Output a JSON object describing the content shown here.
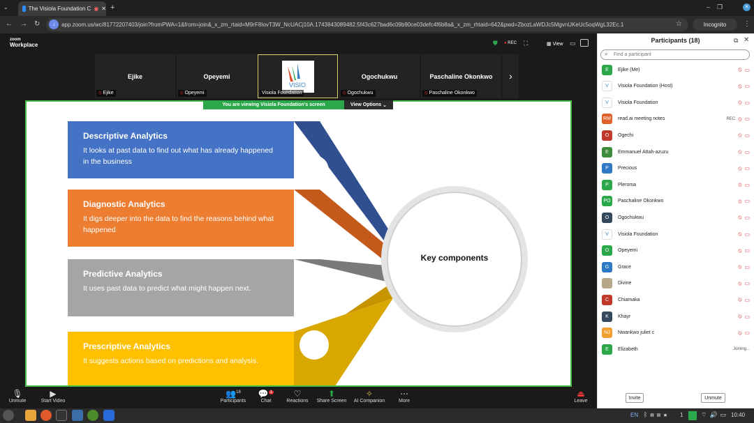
{
  "browser": {
    "tab_title": "The Visiola Foundation C",
    "url": "app.zoom.us/wc/81772207403/join?fromPWA=1&from=join&_x_zm_rtaid=M9rF8IovT3W_NcUACj10A.1743843089482.5f43c627bad6c09b90ce03defc4f6b8a&_x_zm_rhtaid=642&pwd=ZbozLaWDJc5MgvnUKeUc5oqWgL32Ec.1",
    "incognito_label": "Incognito"
  },
  "zoom": {
    "logo_line1": "zoom",
    "logo_line2": "Workplace",
    "rec_label": "REC",
    "view_label": "View",
    "videos": [
      {
        "name": "Ejike",
        "label": "Ejike"
      },
      {
        "name": "Opeyemi",
        "label": "Opeyemi"
      },
      {
        "name": "",
        "label": "Visiola Foundation"
      },
      {
        "name": "Ogochukwu",
        "label": "Ogochukwu"
      },
      {
        "name": "Paschaline Okonkwo",
        "label": "Paschaline Okonkwo"
      }
    ],
    "viewing_banner": "You are viewing  Visiola Foundation's screen",
    "view_options": "View Options"
  },
  "slide": {
    "cards": [
      {
        "title": "Descriptive Analytics",
        "desc": "It looks at past data to find out what has already happened in the business",
        "color": "#4472c4"
      },
      {
        "title": "Diagnostic Analytics",
        "desc": "It digs deeper into the data to find the reasons behind what happened",
        "color": "#ed7d31"
      },
      {
        "title": "Predictive Analytics",
        "desc": "It uses past data to predict what might happen next.",
        "color": "#a5a5a5"
      },
      {
        "title": "Prescriptive Analytics",
        "desc": "It suggests actions based on predictions and analysis.",
        "color": "#ffc000"
      }
    ],
    "center_label": "Key components"
  },
  "toolbar": {
    "items": [
      {
        "label": "Unmute",
        "icon": "mic-off-icon"
      },
      {
        "label": "Start Video",
        "icon": "video-off-icon"
      },
      {
        "label": "Participants",
        "icon": "participants-icon",
        "count": "18"
      },
      {
        "label": "Chat",
        "icon": "chat-icon",
        "badge": "1"
      },
      {
        "label": "Reactions",
        "icon": "heart-icon"
      },
      {
        "label": "Share Screen",
        "icon": "share-screen-icon"
      },
      {
        "label": "AI Companion",
        "icon": "sparkle-icon"
      },
      {
        "label": "More",
        "icon": "more-icon"
      },
      {
        "label": "Leave",
        "icon": "leave-icon"
      }
    ]
  },
  "participants": {
    "title": "Participants (18)",
    "search_placeholder": "Find a participant",
    "list": [
      {
        "initials": "E",
        "name": "Ejike (Me)",
        "color": "#2aa84a",
        "status": ""
      },
      {
        "initials": "",
        "name": "Visiola Foundation (Host)",
        "color": "#ffffff",
        "status": ""
      },
      {
        "initials": "",
        "name": "Visiola Foundation",
        "color": "#ffffff",
        "status": ""
      },
      {
        "initials": "RM",
        "name": "read.ai meeting notes",
        "color": "#e0622b",
        "status": "REC"
      },
      {
        "initials": "O",
        "name": "Ogechi",
        "color": "#c0392b",
        "status": ""
      },
      {
        "initials": "E",
        "name": "Emmanuel Attah-azuzu",
        "color": "#3c8c3c",
        "status": ""
      },
      {
        "initials": "P",
        "name": "Precious",
        "color": "#2f78c4",
        "status": ""
      },
      {
        "initials": "P",
        "name": "Pleroma",
        "color": "#2aa84a",
        "status": ""
      },
      {
        "initials": "PO",
        "name": "Paschaline Okonkwo",
        "color": "#2aa84a",
        "status": ""
      },
      {
        "initials": "O",
        "name": "Ogochukwu",
        "color": "#34495e",
        "status": ""
      },
      {
        "initials": "",
        "name": "Visiola Foundation",
        "color": "#ffffff",
        "status": ""
      },
      {
        "initials": "O",
        "name": "Opeyemi",
        "color": "#2aa84a",
        "status": ""
      },
      {
        "initials": "G",
        "name": "Grace",
        "color": "#2f78c4",
        "status": ""
      },
      {
        "initials": "",
        "name": "Divine",
        "color": "#b8a88a",
        "status": ""
      },
      {
        "initials": "C",
        "name": "Chiamaka",
        "color": "#c0392b",
        "status": ""
      },
      {
        "initials": "K",
        "name": "Khayr",
        "color": "#34495e",
        "status": ""
      },
      {
        "initials": "NJ",
        "name": "Nwankwo juliet c",
        "color": "#f0a030",
        "status": ""
      },
      {
        "initials": "E",
        "name": "Elizabeth",
        "color": "#2aa84a",
        "status": "Joining..."
      }
    ],
    "invite_label": "Invite",
    "unmute_label": "Unmute"
  },
  "taskbar": {
    "lang": "EN",
    "workspace": "1",
    "time": "10:40"
  }
}
